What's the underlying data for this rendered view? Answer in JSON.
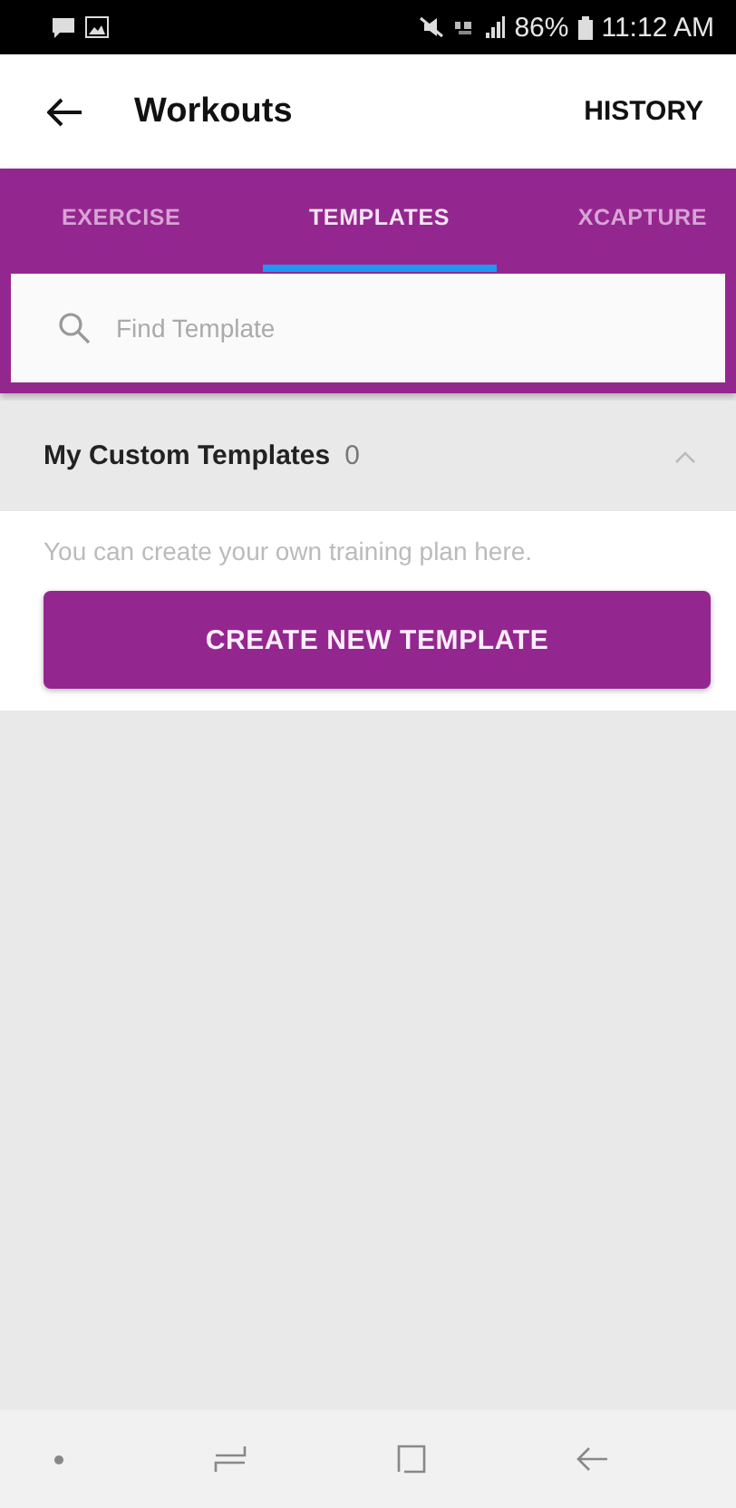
{
  "status_bar": {
    "battery": "86%",
    "time": "11:12 AM"
  },
  "app_bar": {
    "title": "Workouts",
    "action": "HISTORY"
  },
  "tabs": [
    {
      "label": "EXERCISE",
      "selected": false
    },
    {
      "label": "TEMPLATES",
      "selected": true
    },
    {
      "label": "XCAPTURE",
      "selected": false
    }
  ],
  "search": {
    "placeholder": "Find Template"
  },
  "section": {
    "title": "My Custom Templates",
    "count": "0",
    "expanded": true,
    "hint": "You can create your own training plan here.",
    "button": "CREATE NEW TEMPLATE"
  }
}
